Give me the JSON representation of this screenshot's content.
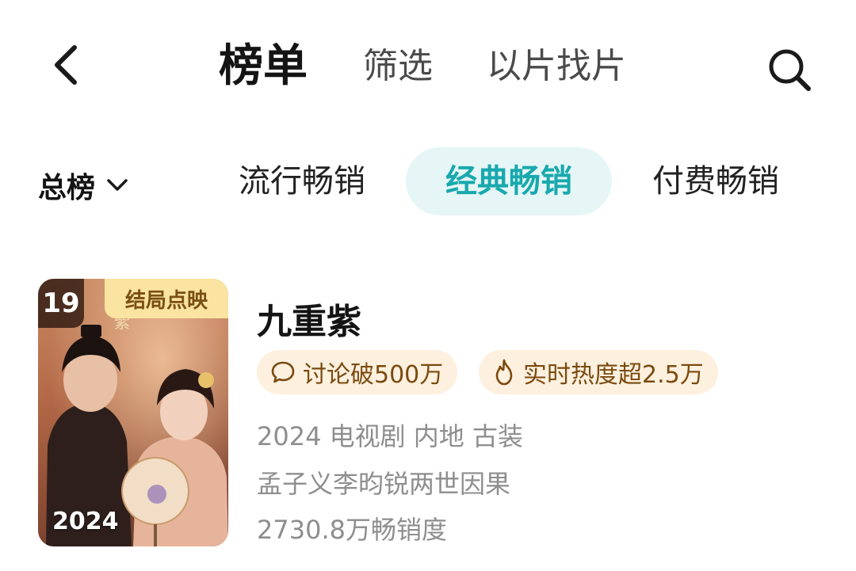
{
  "nav": {
    "tabs": [
      {
        "label": "榜单",
        "active": true
      },
      {
        "label": "筛选",
        "active": false
      },
      {
        "label": "以片找片",
        "active": false
      }
    ],
    "back_icon": "chevron-left-icon",
    "search_icon": "search-icon"
  },
  "filter": {
    "rank_select": {
      "label": "总榜",
      "icon": "chevron-down-icon"
    },
    "sub_tabs": [
      {
        "label": "流行畅销",
        "active": false
      },
      {
        "label": "经典畅销",
        "active": true
      },
      {
        "label": "付费畅销",
        "active": false
      }
    ],
    "active_color": "#18a9ad",
    "active_bg": "#e6f6f7"
  },
  "items": [
    {
      "rank": "19",
      "status_tag": "结局点映",
      "poster_year": "2024",
      "title": "九重紫",
      "pills": [
        {
          "icon": "comment-icon",
          "text": "讨论破500万"
        },
        {
          "icon": "flame-icon",
          "text": "实时热度超2.5万"
        }
      ],
      "meta": "2024 电视剧 内地 古装",
      "description": "孟子义李昀锐两世因果",
      "sales": "2730.8万畅销度"
    }
  ]
}
